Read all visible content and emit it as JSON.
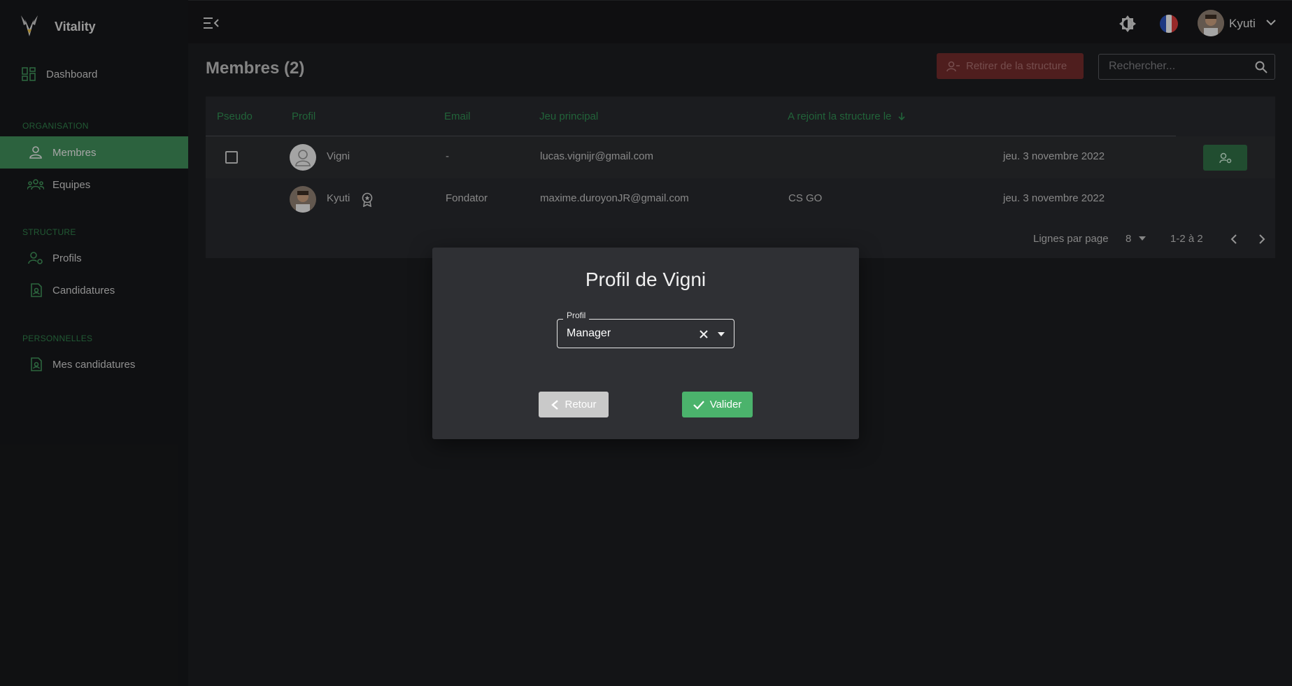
{
  "app": {
    "name": "Vitality"
  },
  "sidebar": {
    "dashboard": "Dashboard",
    "sections": [
      {
        "title": "ORGANISATION",
        "items": [
          {
            "label": "Membres",
            "active": true
          },
          {
            "label": "Equipes"
          }
        ]
      },
      {
        "title": "STRUCTURE",
        "items": [
          {
            "label": "Profils"
          },
          {
            "label": "Candidatures"
          }
        ]
      },
      {
        "title": "PERSONNELLES",
        "items": [
          {
            "label": "Mes candidatures"
          }
        ]
      }
    ]
  },
  "topbar": {
    "user_name": "Kyuti"
  },
  "page": {
    "title": "Membres (2)",
    "remove_button": "Retirer de la structure",
    "search_placeholder": "Rechercher..."
  },
  "table": {
    "columns": [
      "Pseudo",
      "Profil",
      "Email",
      "Jeu principal",
      "A rejoint la structure le"
    ],
    "rows": [
      {
        "pseudo": "Vigni",
        "profil": "-",
        "email": "lucas.vignijr@gmail.com",
        "jeu": "",
        "date": "jeu. 3 novembre 2022"
      },
      {
        "pseudo": "Kyuti",
        "profil": "Fondator",
        "email": "maxime.duroyonJR@gmail.com",
        "jeu": "CS GO",
        "date": "jeu. 3 novembre 2022"
      }
    ],
    "pagination": {
      "rows_per_page_label": "Lignes par page",
      "rows_per_page": "8",
      "range": "1-2 à 2"
    }
  },
  "modal": {
    "title": "Profil de Vigni",
    "field_label": "Profil",
    "field_value": "Manager",
    "back_label": "Retour",
    "ok_label": "Valider"
  },
  "colors": {
    "accent": "#3d8856",
    "ok": "#4bb36c",
    "danger": "#6e2a2a"
  }
}
